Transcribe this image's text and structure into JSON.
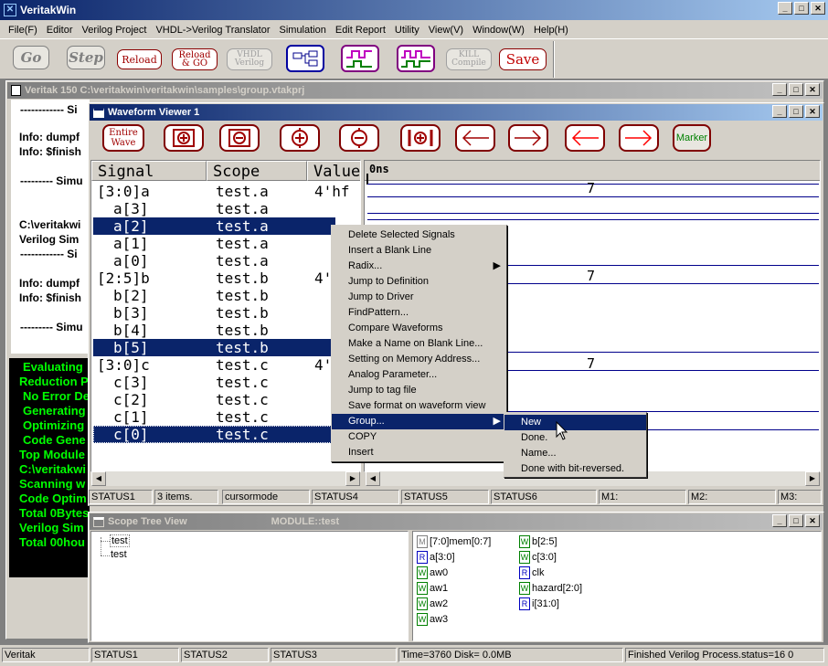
{
  "app": {
    "title": "VeritakWin"
  },
  "menubar": [
    "File(F)",
    "Editor",
    "Verilog Project",
    "VHDL->Verilog Translator",
    "Simulation",
    "Edit Report",
    "Utility",
    "View(V)",
    "Window(W)",
    "Help(H)"
  ],
  "toolbar": {
    "go": "Go",
    "step": "Step",
    "reload": "Reload",
    "reload_go_1": "Reload",
    "reload_go_2": "& GO",
    "vhdl_1": "VHDL",
    "vhdl_2": "Verilog",
    "kill_1": "KILL",
    "kill_2": "Compile",
    "save": "Save"
  },
  "project_window": {
    "title": "Veritak 150 C:\\veritakwin\\veritakwin\\samples\\group.vtakprj"
  },
  "log_lines": [
    "------------ Si",
    "Info: dumpf",
    "Info: $finish",
    "--------- Simu",
    "C:\\veritakwi",
    "Verilog Sim",
    "------------ Si",
    "Info: dumpf",
    "Info: $finish",
    "--------- Simu"
  ],
  "console_lines": [
    "Evaluating",
    "Reduction P",
    "No Error De",
    "Generating",
    "Optimizing",
    "Code Gene",
    "Top Module",
    "C:\\veritakwi",
    "Scanning w",
    "Code Optim",
    "Total 0Bytes",
    "Verilog Sim",
    "Total  00hou"
  ],
  "waveform": {
    "title": "Waveform Viewer 1",
    "buttons": {
      "entire_1": "Entire",
      "entire_2": "Wave",
      "marker": "Marker"
    },
    "headers": {
      "signal": "Signal",
      "scope": "Scope",
      "value": "Value"
    },
    "time_label": "0ns",
    "rows": [
      {
        "name": "[3:0]a",
        "scope": "test.a",
        "value": "4'hf"
      },
      {
        "name": "  a[3]",
        "scope": "test.a",
        "value": ""
      },
      {
        "name": "  a[2]",
        "scope": "test.a",
        "value": ""
      },
      {
        "name": "  a[1]",
        "scope": "test.a",
        "value": ""
      },
      {
        "name": "  a[0]",
        "scope": "test.a",
        "value": ""
      },
      {
        "name": "[2:5]b",
        "scope": "test.b",
        "value": "4'"
      },
      {
        "name": "  b[2]",
        "scope": "test.b",
        "value": ""
      },
      {
        "name": "  b[3]",
        "scope": "test.b",
        "value": ""
      },
      {
        "name": "  b[4]",
        "scope": "test.b",
        "value": ""
      },
      {
        "name": "  b[5]",
        "scope": "test.b",
        "value": ""
      },
      {
        "name": "[3:0]c",
        "scope": "test.c",
        "value": "4'"
      },
      {
        "name": "  c[3]",
        "scope": "test.c",
        "value": ""
      },
      {
        "name": "  c[2]",
        "scope": "test.c",
        "value": ""
      },
      {
        "name": "  c[1]",
        "scope": "test.c",
        "value": ""
      },
      {
        "name": "  c[0]",
        "scope": "test.c",
        "value": ""
      }
    ],
    "bus_values": [
      "7",
      "7",
      "7"
    ],
    "status": [
      "STATUS1",
      "3 items.",
      "cursormode",
      "STATUS4",
      "STATUS5",
      "STATUS6",
      "M1:",
      "M2:",
      "M3:"
    ]
  },
  "context_menu": [
    "Delete Selected Signals",
    "Insert a Blank Line",
    "Radix...",
    "Jump to Definition",
    "Jump to Driver",
    "FindPattern...",
    "Compare Waveforms",
    "Make a Name on Blank Line...",
    "Setting on Memory Address...",
    "Analog Parameter...",
    "Jump to tag file",
    "Save format on waveform view",
    "Group...",
    "COPY",
    "Insert"
  ],
  "submenu": [
    "New",
    "Done.",
    "Name...",
    "Done with bit-reversed."
  ],
  "scope_tree": {
    "title": "Scope Tree View",
    "module_label": "MODULE::test",
    "items": [
      "test",
      "test"
    ],
    "signals_col1": [
      {
        "badge": "M",
        "name": "[7:0]mem[0:7]"
      },
      {
        "badge": "R",
        "name": "a[3:0]"
      },
      {
        "badge": "W",
        "name": "aw0"
      },
      {
        "badge": "W",
        "name": "aw1"
      },
      {
        "badge": "W",
        "name": "aw2"
      },
      {
        "badge": "W",
        "name": "aw3"
      }
    ],
    "signals_col2": [
      {
        "badge": "W",
        "name": "b[2:5]"
      },
      {
        "badge": "W",
        "name": "c[3:0]"
      },
      {
        "badge": "R",
        "name": "clk"
      },
      {
        "badge": "W",
        "name": "hazard[2:0]"
      },
      {
        "badge": "R",
        "name": "i[31:0]"
      }
    ]
  },
  "main_status": [
    "Veritak",
    "STATUS1",
    "STATUS2",
    "STATUS3",
    "Time=3760 Disk=  0.0MB",
    "Finished Verilog Process.status=16 0"
  ]
}
